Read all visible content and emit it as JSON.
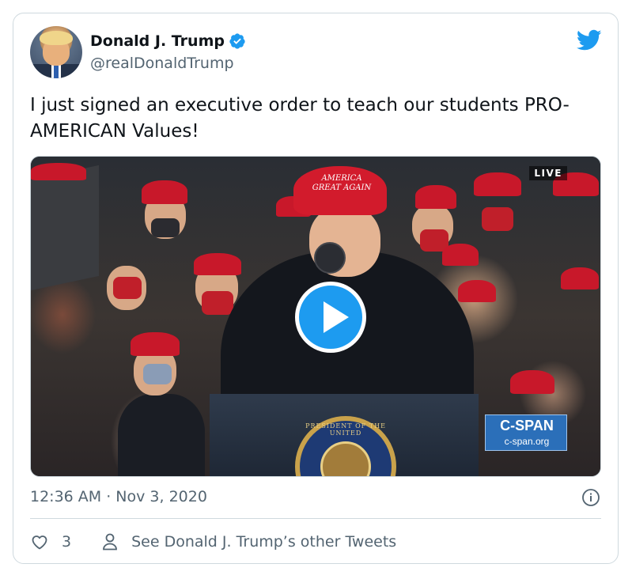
{
  "tweet": {
    "author_name": "Donald J. Trump",
    "author_handle": "@realDonaldTrump",
    "text": "I just signed an executive order to teach our students PRO-AMERICAN Values!",
    "timestamp": "12:36 AM · Nov 3, 2020"
  },
  "media": {
    "live_label": "LIVE",
    "network_name": "C-SPAN",
    "network_url": "c-span.org",
    "hat_text": "AMERICA GREAT AGAIN",
    "seal_text": "PRESIDENT OF THE UNITED"
  },
  "actions": {
    "like_count": "3",
    "other_tweets_label": "See Donald J. Trump’s other Tweets"
  },
  "colors": {
    "twitter_blue": "#1d9bf0",
    "secondary_text": "#536471",
    "border": "#cfd9de",
    "cspan_blue": "#2b6fb9"
  },
  "icons": [
    "verified-badge-icon",
    "twitter-bird-icon",
    "play-icon",
    "info-icon",
    "heart-icon",
    "person-icon"
  ]
}
